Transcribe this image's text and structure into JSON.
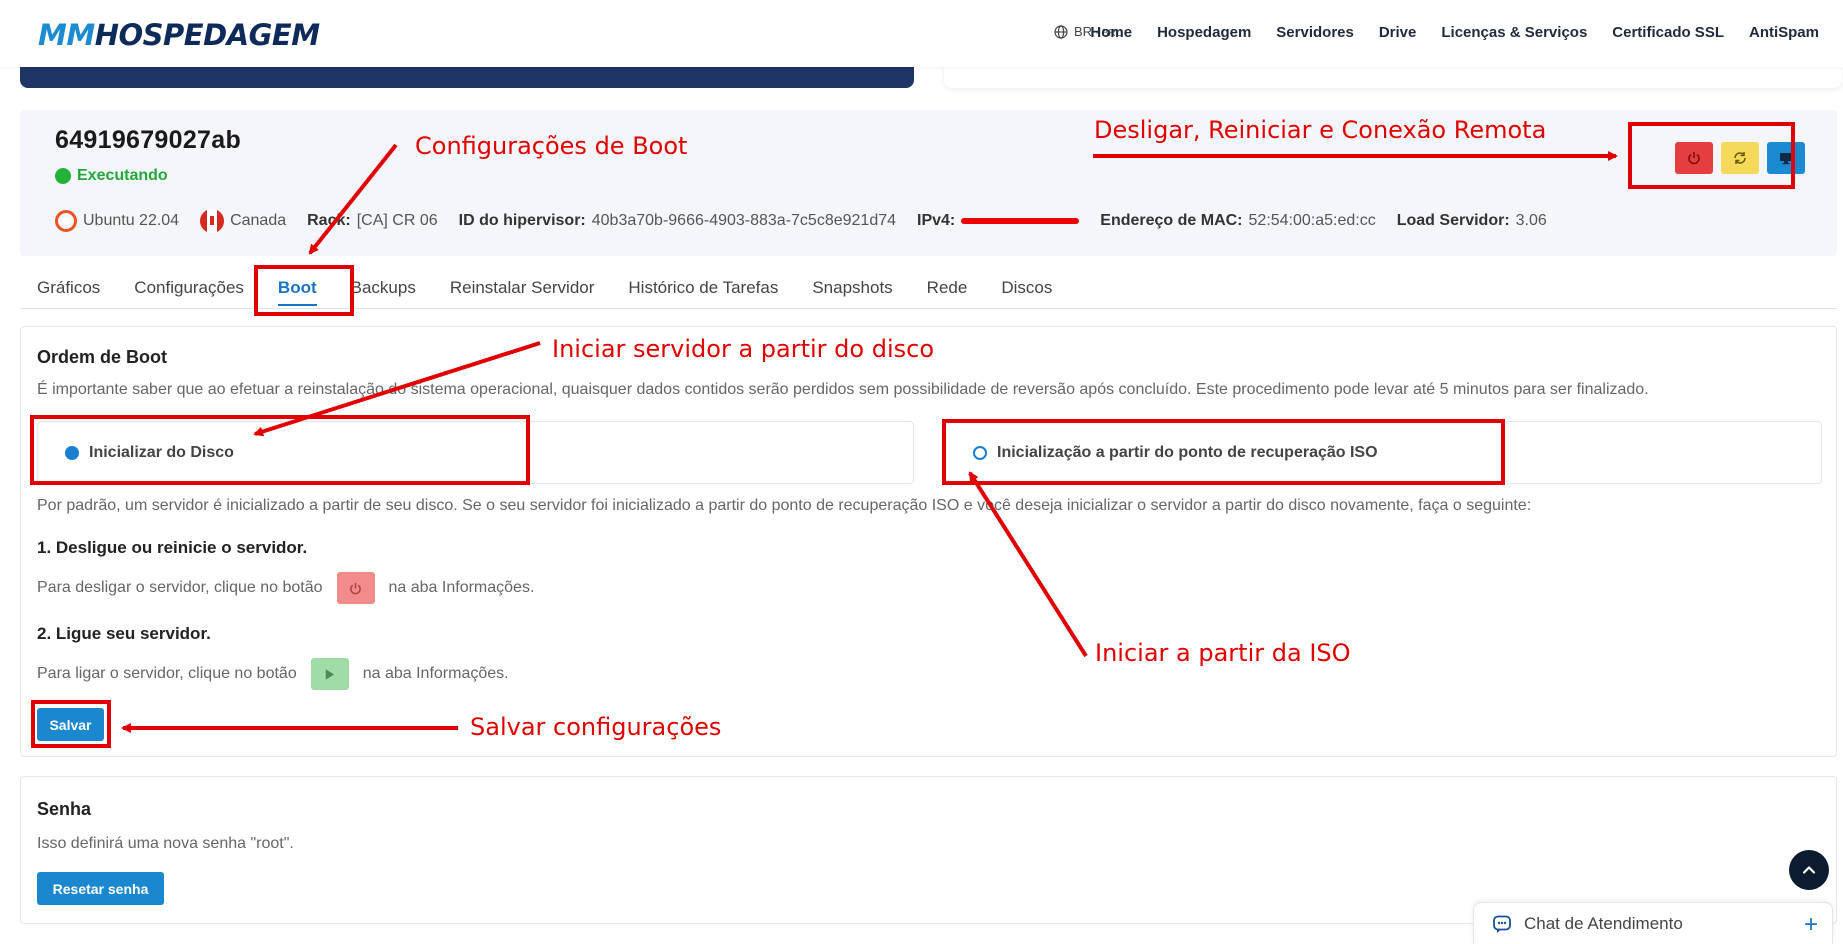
{
  "header": {
    "logo_mm": "MM",
    "logo_rest": "HOSPEDAGEM",
    "lang_code": "BR",
    "lang_currency": "- BRL",
    "nav": [
      "Home",
      "Hospedagem",
      "Servidores",
      "Drive",
      "Licenças & Serviços",
      "Certificado SSL",
      "AntiSpam"
    ]
  },
  "server": {
    "id": "64919679027ab",
    "status": "Executando",
    "os": "Ubuntu 22.04",
    "country": "Canada",
    "rack_label": "Rack:",
    "rack_value": "[CA] CR 06",
    "hypervisor_label": "ID do hipervisor:",
    "hypervisor_value": "40b3a70b-9666-4903-883a-7c5c8e921d74",
    "ipv4_label": "IPv4:",
    "mac_label": "Endereço de MAC:",
    "mac_value": "52:54:00:a5:ed:cc",
    "load_label": "Load Servidor:",
    "load_value": "3.06"
  },
  "tabs": [
    "Gráficos",
    "Configurações",
    "Boot",
    "Backups",
    "Reinstalar Servidor",
    "Histórico de Tarefas",
    "Snapshots",
    "Rede",
    "Discos"
  ],
  "boot": {
    "title": "Ordem de Boot",
    "description": "É importante saber que ao efetuar a reinstalação do sistema operacional, quaisquer dados contidos serão perdidos sem possibilidade de reversão após concluído. Este procedimento pode levar até 5 minutos para ser finalizado.",
    "option_disk": "Inicializar do Disco",
    "option_iso": "Inicialização a partir do ponto de recuperação ISO",
    "default_text": "Por padrão, um servidor é inicializado a partir de seu disco. Se o seu servidor foi inicializado a partir do ponto de recuperação ISO e você deseja inicializar o servidor a partir do disco novamente, faça o seguinte:",
    "step1_title": "1. Desligue ou reinicie o servidor.",
    "step1_before": "Para desligar o servidor, clique no botão",
    "step1_after": "na aba Informações.",
    "step2_title": "2. Ligue seu servidor.",
    "step2_before": "Para ligar o servidor, clique no botão",
    "step2_after": "na aba Informações.",
    "save": "Salvar"
  },
  "password": {
    "title": "Senha",
    "description": "Isso definirá uma nova senha \"root\".",
    "reset": "Resetar senha"
  },
  "chat": {
    "label": "Chat de Atendimento"
  },
  "annotations": {
    "boot_config": "Configurações de Boot",
    "power_actions": "Desligar, Reiniciar e Conexão Remota",
    "start_disk": "Iniciar servidor a partir do disco",
    "start_iso": "Iniciar a partir da ISO",
    "save_config": "Salvar configurações"
  },
  "colors": {
    "accent": "#1a87cf",
    "annotation": "#e00000",
    "status_green": "#22a83a"
  }
}
